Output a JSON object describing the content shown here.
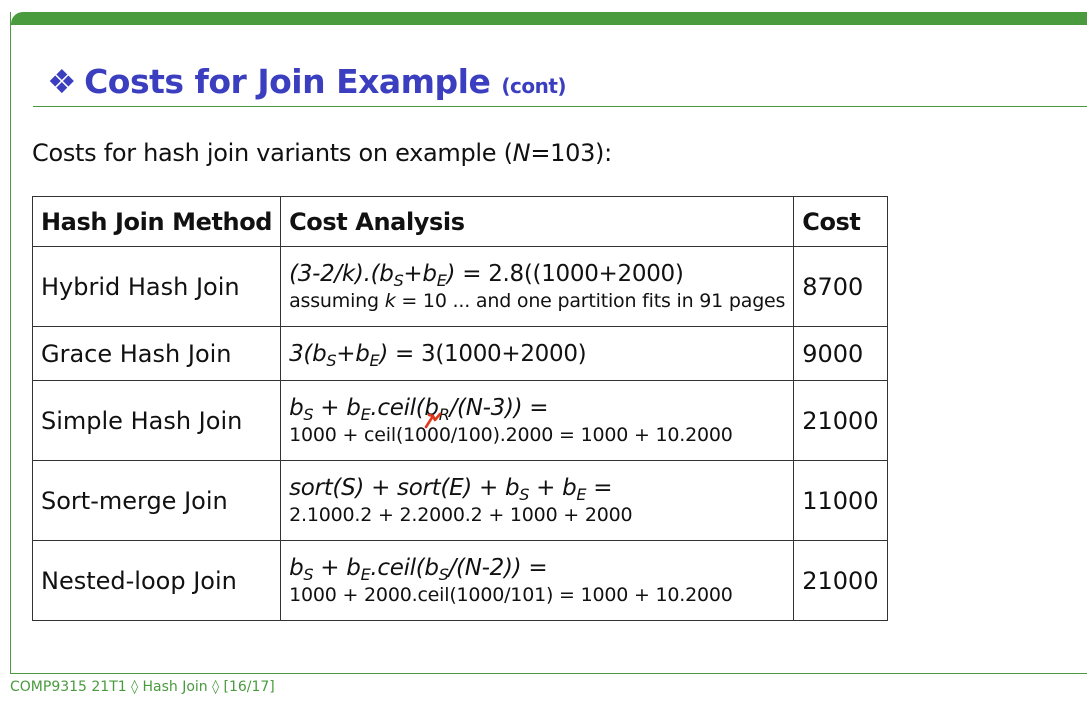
{
  "title": {
    "bullet": "❖",
    "main": "Costs for Join Example",
    "suffix": "(cont)"
  },
  "intro": {
    "before": "Costs for hash join variants on example (",
    "var": "N",
    "after": "=103):"
  },
  "table": {
    "headers": [
      "Hash Join Method",
      "Cost Analysis",
      "Cost"
    ],
    "rows": [
      {
        "method": "Hybrid Hash Join",
        "note_a": "assuming ",
        "note_k": "k",
        "note_b": " = 10 ... and one partition fits in 91 pages",
        "cost": "8700"
      },
      {
        "method": "Grace Hash Join",
        "cost": "9000"
      },
      {
        "method": "Simple Hash Join",
        "note": "1000 + ceil(1000/100).2000 = 1000 + 10.2000",
        "cost": "21000"
      },
      {
        "method": "Sort-merge Join",
        "note": "2.1000.2 + 2.2000.2 + 1000 + 2000",
        "cost": "11000"
      },
      {
        "method": "Nested-loop Join",
        "note": "1000 + 2000.ceil(1000/101) = 1000 + 10.2000",
        "cost": "21000"
      }
    ]
  },
  "formulas": {
    "hybrid": {
      "a": "(3-2/k).(b",
      "s1": "S",
      "b": "+b",
      "s2": "E",
      "c": ")",
      "d": " = 2.8((1000+2000)"
    },
    "grace": {
      "a": "3(b",
      "s1": "S",
      "b": "+b",
      "s2": "E",
      "c": ")",
      "d": " = 3(1000+2000)"
    },
    "simple": {
      "a": "b",
      "s1": "S",
      "b": " + b",
      "s2": "E",
      "c": ".ceil(b",
      "s3": "R",
      "d": "/(N-3)) ="
    },
    "sortmerge": {
      "a": "sort(S) + sort(E) + b",
      "s1": "S",
      "b": " + b",
      "s2": "E",
      "c": " ="
    },
    "nested": {
      "a": "b",
      "s1": "S",
      "b": " + b",
      "s2": "E",
      "c": ".ceil(b",
      "s3": "S",
      "d": "/(N-2)) ="
    }
  },
  "footer": "COMP9315 21T1 ◊ Hash Join ◊ [16/17]",
  "colors": {
    "accent_green": "#4a9a3e",
    "title_blue": "#3b3fbf",
    "cursor_red": "#e03a1e"
  },
  "icons": {
    "title_bullet": "diamond-bullet-icon",
    "pointer": "pointer-cursor-icon"
  }
}
